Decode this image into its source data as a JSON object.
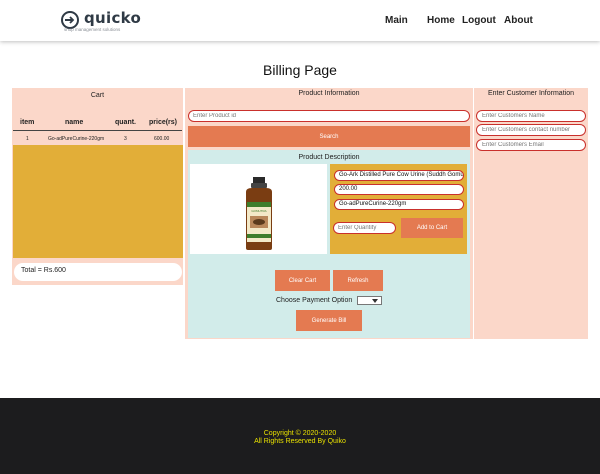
{
  "header": {
    "logo_text": "quicko",
    "logo_tagline": "shop management solutions",
    "nav": [
      "Main",
      "Home",
      "Logout",
      "About"
    ]
  },
  "page_title": "Billing Page",
  "cart": {
    "title": "Cart",
    "columns": [
      "item",
      "name",
      "quant.",
      "price(rs)"
    ],
    "rows": [
      {
        "item": "1",
        "name": "Go-adPureCurine-220gm",
        "quant": "3",
        "price": "600.00"
      }
    ],
    "total_label": "Total = Rs.600"
  },
  "product": {
    "title": "Product Information",
    "id_placeholder": "Enter Product id",
    "search_label": "Search",
    "description_title": "Product Description",
    "name_value": "Go-Ark Distilled Pure Cow Urine (Suddh Gomutra)",
    "price_value": "200.00",
    "code_value": "Go-adPureCurine-220gm",
    "quantity_placeholder": "Enter Quantity",
    "add_label": "Add to Cart",
    "image_text": "GOMUTRA"
  },
  "actions": {
    "clear_label": "Clear Cart",
    "refresh_label": "Refresh",
    "payment_label": "Choose Payment Option",
    "generate_label": "Generate Bill"
  },
  "customer": {
    "title": "Enter Customer Information",
    "name_placeholder": "Enter Customers Name",
    "contact_placeholder": "Enter Customers contact number",
    "email_placeholder": "Enter Customers Email"
  },
  "footer": {
    "copyright": "Copyright © 2020-2020",
    "rights": "All Rights Reserved By Quiko"
  },
  "colors": {
    "panel_bg": "#fbd7c9",
    "cart_bg": "#e2ae38",
    "button": "#e47a51",
    "desc_bg": "#d2ecea",
    "input_border": "#c9302c",
    "footer_bg": "#1c1c1e",
    "footer_text": "#e8e000"
  }
}
